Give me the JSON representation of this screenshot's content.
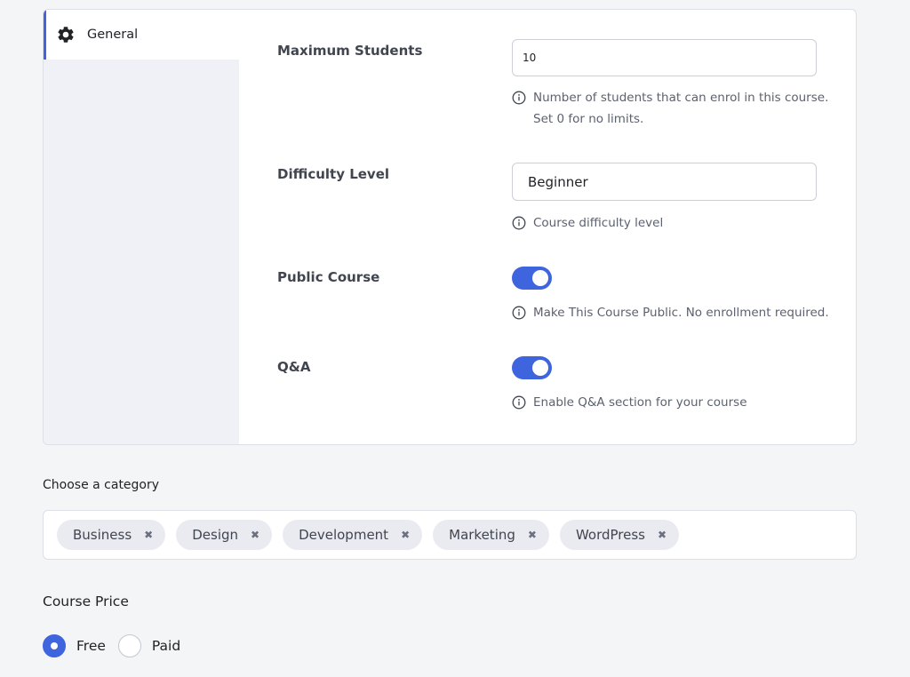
{
  "colors": {
    "accent": "#3e64de",
    "sidebar_bg": "#eff1f6",
    "chip_bg": "#e9ebf0"
  },
  "sidebar": {
    "tabs": [
      {
        "label": "General",
        "icon": "gear-icon",
        "active": true
      }
    ]
  },
  "settings": {
    "max_students": {
      "label": "Maximum Students",
      "value": "10",
      "help_line1": "Number of students that can enrol in this course.",
      "help_line2": "Set 0 for no limits."
    },
    "difficulty": {
      "label": "Difficulty Level",
      "value": "Beginner",
      "help": "Course difficulty level"
    },
    "public_course": {
      "label": "Public Course",
      "enabled": true,
      "help": "Make This Course Public. No enrollment required."
    },
    "qa": {
      "label": "Q&A",
      "enabled": true,
      "help": "Enable Q&A section for your course"
    }
  },
  "category": {
    "heading": "Choose a category",
    "chips": [
      "Business",
      "Design",
      "Development",
      "Marketing",
      "WordPress"
    ],
    "remove_glyph": "✖"
  },
  "price": {
    "heading": "Course Price",
    "options": [
      {
        "label": "Free",
        "checked": true
      },
      {
        "label": "Paid",
        "checked": false
      }
    ]
  }
}
